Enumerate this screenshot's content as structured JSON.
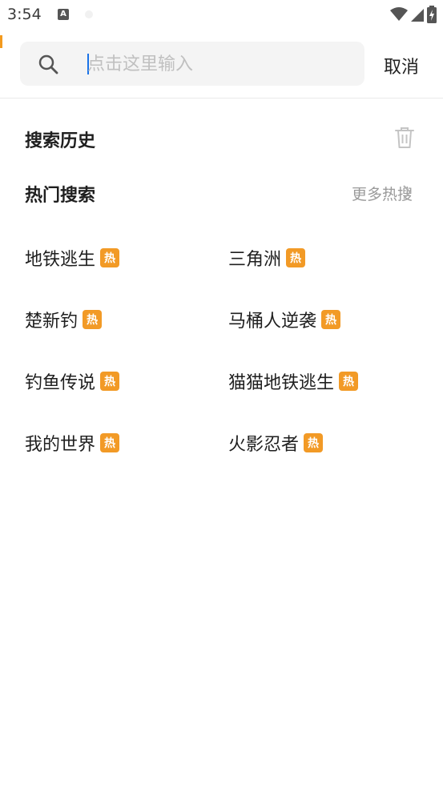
{
  "status": {
    "time": "3:54",
    "notification_letter": "A"
  },
  "search": {
    "placeholder": "点击这里输入",
    "cancel_label": "取消"
  },
  "history": {
    "title": "搜索历史"
  },
  "hot": {
    "title": "热门搜索",
    "more_label": "更多热搜",
    "badge_label": "热",
    "items": [
      {
        "label": "地铁逃生"
      },
      {
        "label": "三角洲"
      },
      {
        "label": "楚新钓"
      },
      {
        "label": "马桶人逆袭"
      },
      {
        "label": "钓鱼传说"
      },
      {
        "label": "猫猫地铁逃生"
      },
      {
        "label": "我的世界"
      },
      {
        "label": "火影忍者"
      }
    ]
  },
  "colors": {
    "accent": "#f29a26",
    "caret": "#1a73e8"
  }
}
